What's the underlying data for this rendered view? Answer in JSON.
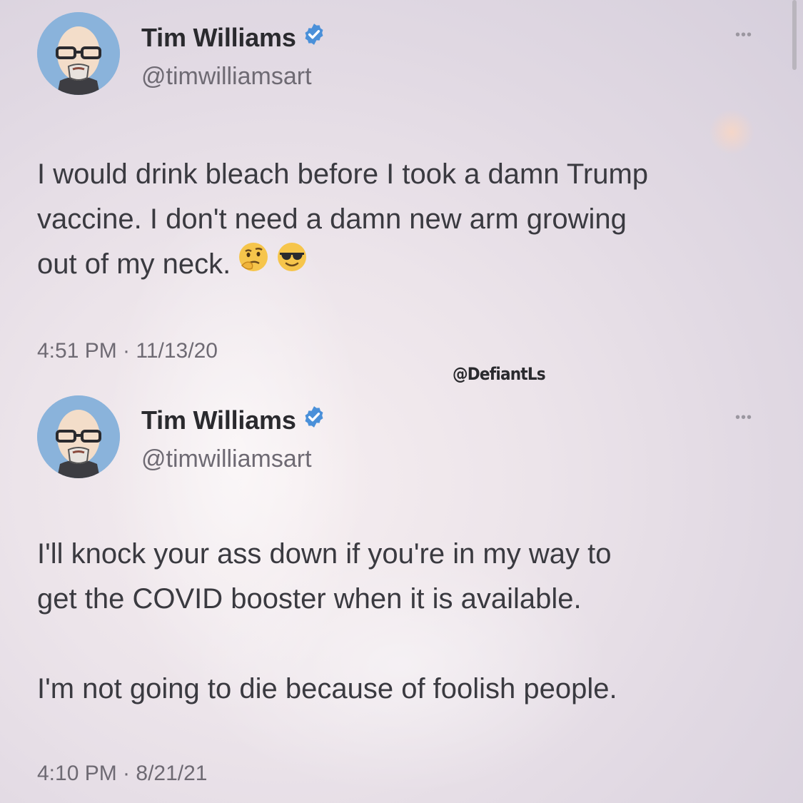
{
  "watermark": "@DefiantLs",
  "tweets": [
    {
      "name": "Tim Williams",
      "handle": "@timwilliamsart",
      "more_label": "•••",
      "text_lines": [
        "I would drink bleach before I took a damn Trump",
        "vaccine. I don't need a damn new arm growing",
        "out of my neck."
      ],
      "emojis": [
        "thinking-face-icon",
        "smiling-face-with-sunglasses-icon"
      ],
      "timestamp": "4:51 PM · 11/13/20"
    },
    {
      "name": "Tim Williams",
      "handle": "@timwilliamsart",
      "more_label": "•••",
      "paragraphs": [
        [
          "I'll knock your ass down if you're in my way to",
          "get the COVID booster when it is available."
        ],
        [
          "I'm not going to die because of foolish people."
        ]
      ],
      "timestamp": "4:10 PM · 8/21/21"
    }
  ],
  "colors": {
    "verified_badge": "#4a90d9",
    "avatar_bg": "#8ab3db",
    "text": "#3a3a40",
    "secondary_text": "#6e6a73"
  }
}
